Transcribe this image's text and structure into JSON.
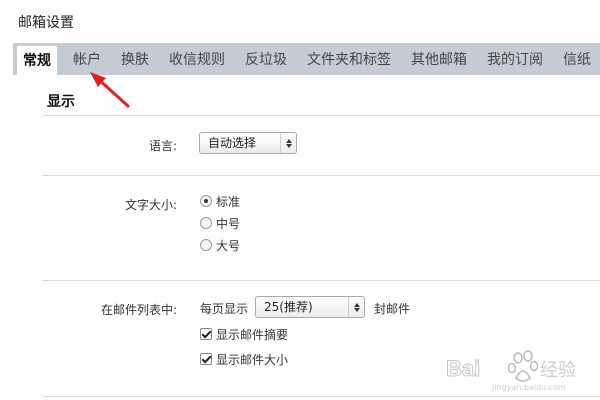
{
  "page": {
    "title": "邮箱设置"
  },
  "tabs": [
    {
      "label": "常规",
      "active": true
    },
    {
      "label": "帐户",
      "active": false
    },
    {
      "label": "换肤",
      "active": false
    },
    {
      "label": "收信规则",
      "active": false
    },
    {
      "label": "反垃圾",
      "active": false
    },
    {
      "label": "文件夹和标签",
      "active": false
    },
    {
      "label": "其他邮箱",
      "active": false
    },
    {
      "label": "我的订阅",
      "active": false
    },
    {
      "label": "信纸",
      "active": false
    }
  ],
  "section": {
    "title": "显示"
  },
  "language": {
    "label": "语言:",
    "selected": "自动选择"
  },
  "font_size": {
    "label": "文字大小:",
    "options": [
      {
        "label": "标准",
        "checked": true
      },
      {
        "label": "中号",
        "checked": false
      },
      {
        "label": "大号",
        "checked": false
      }
    ]
  },
  "mail_list": {
    "label": "在邮件列表中:",
    "per_page_prefix": "每页显示",
    "per_page_value": "25(推荐)",
    "per_page_suffix": "封邮件",
    "checkboxes": [
      {
        "label": "显示邮件摘要",
        "checked": true
      },
      {
        "label": "显示邮件大小",
        "checked": true
      }
    ]
  },
  "annotation": {
    "arrow_color": "#e02020"
  },
  "watermark": {
    "text": "Bai度经验",
    "subtext": "jingyan.baidu.com"
  }
}
